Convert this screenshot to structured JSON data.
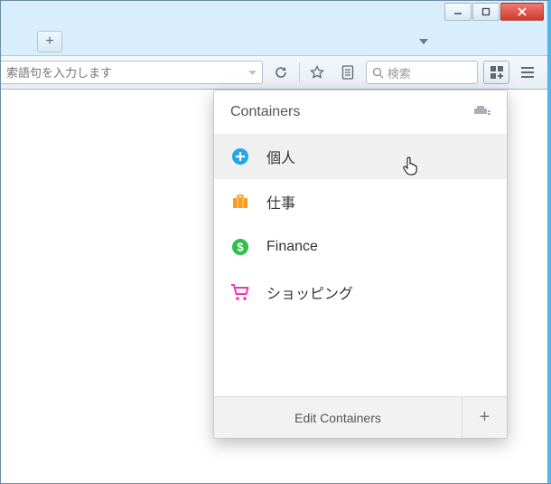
{
  "urlbar": {
    "placeholder": "索語句を入力します"
  },
  "searchbox": {
    "placeholder": "検索"
  },
  "panel": {
    "title": "Containers",
    "footer_edit": "Edit Containers",
    "items": [
      {
        "label": "個人",
        "icon": "plus-circle",
        "color": "#1fa8f0"
      },
      {
        "label": "仕事",
        "icon": "briefcase",
        "color": "#ff9a1a"
      },
      {
        "label": "Finance",
        "icon": "dollar-circle",
        "color": "#2fbf4a"
      },
      {
        "label": "ショッピング",
        "icon": "cart",
        "color": "#ff2fb6"
      }
    ]
  }
}
